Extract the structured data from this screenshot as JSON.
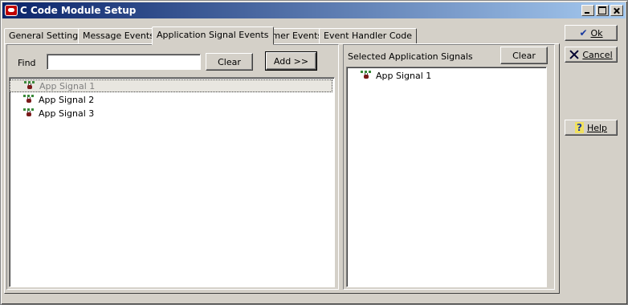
{
  "window": {
    "title": "C Code Module Setup"
  },
  "tabs": [
    {
      "label": "General Settings"
    },
    {
      "label": "Message Events"
    },
    {
      "label": "Application Signal Events"
    },
    {
      "label": "Timer Events"
    },
    {
      "label": "Event Handler Code"
    }
  ],
  "active_tab": "Application Signal Events",
  "left_panel": {
    "find_label": "Find",
    "find_value": "",
    "clear_label": "Clear",
    "add_label": "Add >>",
    "items": [
      {
        "label": "App Signal 1",
        "selected": true
      },
      {
        "label": "App Signal 2",
        "selected": false
      },
      {
        "label": "App Signal 3",
        "selected": false
      }
    ]
  },
  "right_panel": {
    "title": "Selected Application Signals",
    "clear_label": "Clear",
    "items": [
      {
        "label": "App Signal 1"
      }
    ]
  },
  "buttons": {
    "ok_label": "Ok",
    "cancel_label": "Cancel",
    "help_label": "Help"
  },
  "icons": {
    "app": "app-icon",
    "signal": "app-signal-icon",
    "ok": "checkmark-icon",
    "cancel": "x-icon",
    "help": "question-icon"
  }
}
